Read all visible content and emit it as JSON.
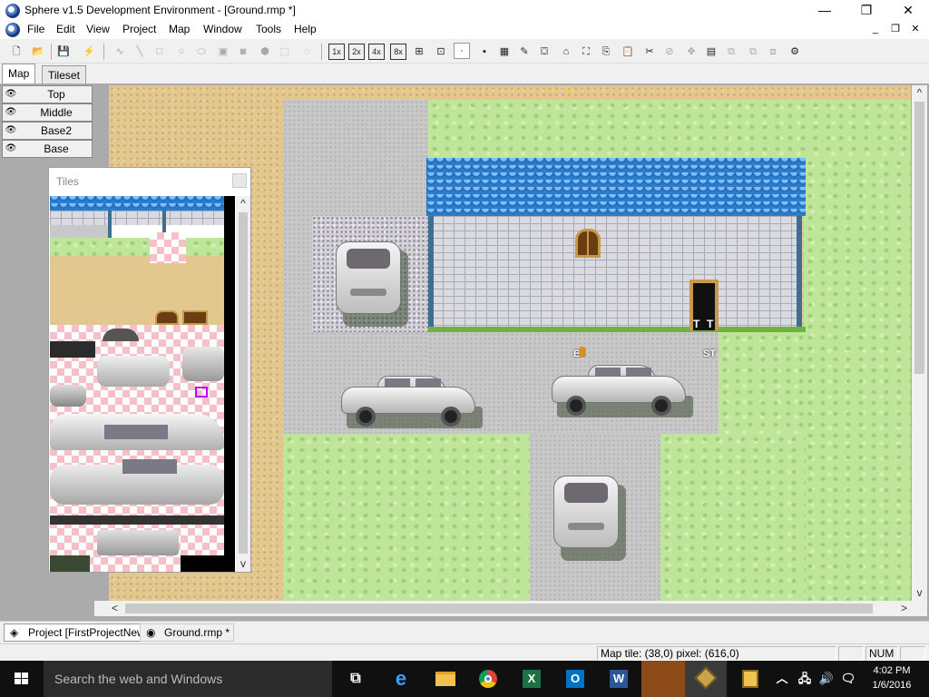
{
  "window": {
    "title": "Sphere v1.5 Development Environment - [Ground.rmp *]",
    "app_icon": "sphere-icon",
    "minimize_glyph": "—",
    "maximize_glyph": "❐",
    "close_glyph": "✕"
  },
  "menu": {
    "items": [
      "File",
      "Edit",
      "View",
      "Project",
      "Map",
      "Window",
      "Tools",
      "Help"
    ],
    "mdi_minimize": "_",
    "mdi_restore": "❐",
    "mdi_close": "✕"
  },
  "toolbar": {
    "zoom_labels": [
      "1x",
      "2x",
      "4x",
      "8x"
    ],
    "icons": [
      "new-icon",
      "open-icon",
      "save-icon",
      "wand-icon",
      "line-icon",
      "rectangle-icon",
      "ellipse-icon",
      "fill-icon",
      "grid-icon",
      "select-icon"
    ]
  },
  "tabs": {
    "map": "Map",
    "tileset": "Tileset"
  },
  "layers": [
    "Top",
    "Middle",
    "Base2",
    "Base"
  ],
  "tiles_window": {
    "title": "Tiles"
  },
  "map": {
    "markers": {
      "trigger_1": "T",
      "trigger_2": "T",
      "start": "ST",
      "entity": "B"
    }
  },
  "scroll": {
    "left": "<",
    "right": ">",
    "up": "^",
    "down": "v"
  },
  "doc_tabs": [
    "Project [FirstProjectNew]",
    "Ground.rmp *"
  ],
  "status": {
    "position": "Map tile: (38,0) pixel: (616,0)",
    "num": "NUM"
  },
  "taskbar": {
    "search_placeholder": "Search the web and Windows",
    "time": "4:02 PM",
    "date": "1/6/2016",
    "apps": [
      "task-view-icon",
      "edge-icon",
      "file-explorer-icon",
      "chrome-icon",
      "excel-icon",
      "outlook-icon",
      "word-icon",
      "sphere-icon",
      "sphere-editor-icon"
    ]
  },
  "colors": {
    "grass": "#bfe59a",
    "sand": "#e2c78f",
    "roof": "#2a7ed0",
    "wall": "#d9dbe0",
    "road": "#c8c8c8",
    "taskbar": "#101010"
  }
}
